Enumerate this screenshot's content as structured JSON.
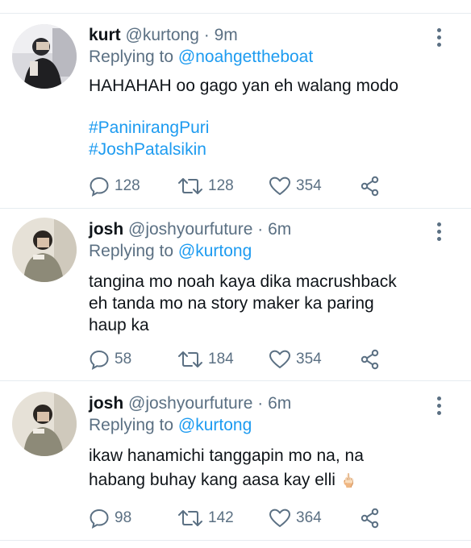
{
  "tweets": [
    {
      "name": "kurt",
      "handle": "@kurtong",
      "dot": "·",
      "time": "9m",
      "replying_prefix": "Replying to",
      "replying_to": "@noahgettheboat",
      "text": "HAHAHAH oo gago yan eh walang modo",
      "hashtags": [
        "#PaninirangPuri",
        "#JoshPatalsikin"
      ],
      "replies": "128",
      "retweets": "128",
      "likes": "354"
    },
    {
      "name": "josh",
      "handle": "@joshyourfuture",
      "dot": "·",
      "time": "6m",
      "replying_prefix": "Replying to",
      "replying_to": "@kurtong",
      "text_lines": [
        "tangina mo noah kaya dika macrushback",
        "eh tanda mo na story maker ka paring",
        "haup ka"
      ],
      "replies": "58",
      "retweets": "184",
      "likes": "354"
    },
    {
      "name": "josh",
      "handle": "@joshyourfuture",
      "dot": "·",
      "time": "6m",
      "replying_prefix": "Replying to",
      "replying_to": "@kurtong",
      "text_lines": [
        "ikaw hanamichi tanggapin mo na, na",
        "habang buhay kang aasa kay elli"
      ],
      "emoji": "🖕🏻",
      "replies": "98",
      "retweets": "142",
      "likes": "364"
    }
  ],
  "icons": {
    "more": "more-vertical-icon",
    "reply": "reply-bubble-icon",
    "retweet": "retweet-icon",
    "like": "heart-icon",
    "share": "share-icon"
  },
  "colors": {
    "link": "#1d9bf0",
    "secondary": "#5b7083",
    "divider": "#e6ecf0"
  }
}
